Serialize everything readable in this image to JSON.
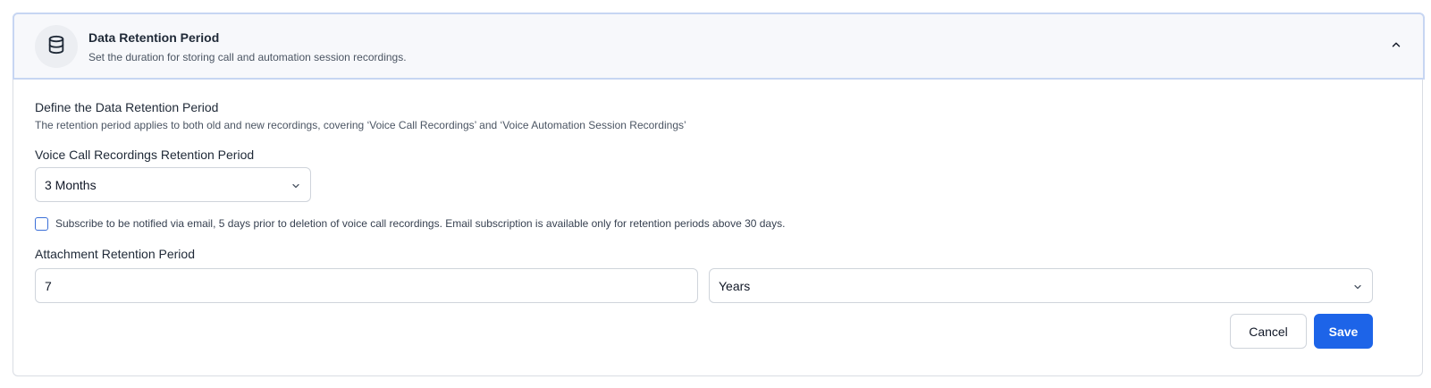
{
  "header": {
    "icon": "database-icon",
    "title": "Data Retention Period",
    "subtitle": "Set the duration for storing call and automation session recordings.",
    "collapse_icon": "chevron-up-icon"
  },
  "section": {
    "title": "Define the Data Retention Period",
    "description": "The retention period applies to both old and new recordings, covering ‘Voice Call Recordings’ and ‘Voice Automation Session Recordings’"
  },
  "voice_call": {
    "label": "Voice Call Recordings Retention Period",
    "selected": "3 Months"
  },
  "subscribe": {
    "checked": false,
    "label": "Subscribe to be notified via email, 5 days prior to deletion of voice call recordings. Email subscription is available only for retention periods above 30 days."
  },
  "attachment": {
    "label": "Attachment Retention Period",
    "value": "7",
    "unit": "Years"
  },
  "actions": {
    "cancel_label": "Cancel",
    "save_label": "Save"
  },
  "colors": {
    "accent": "#1d64e8",
    "header_bg": "#f7f8fb",
    "header_border": "#c7d6f2"
  }
}
